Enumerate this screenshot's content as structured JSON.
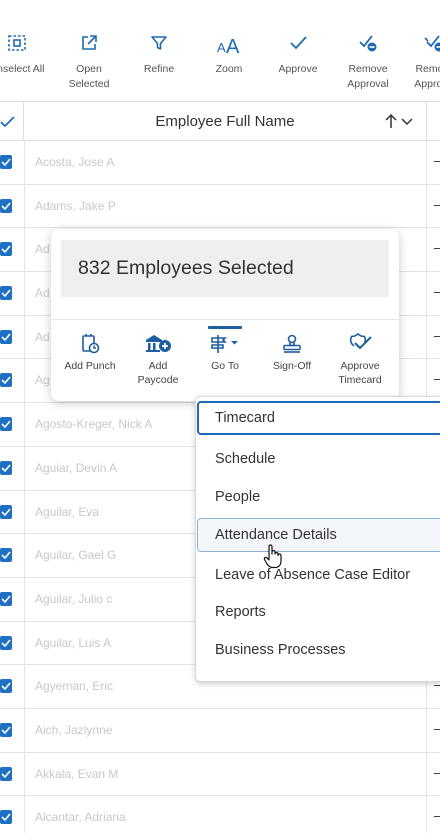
{
  "toolbar": {
    "items": [
      {
        "label": "Unselect All",
        "icon": "unselect-all-icon"
      },
      {
        "label": "Open\nSelected",
        "icon": "open-external-icon"
      },
      {
        "label": "Refine",
        "icon": "filter-icon"
      },
      {
        "label": "Zoom",
        "icon": "zoom-text-icon"
      },
      {
        "label": "Approve",
        "icon": "check-icon"
      },
      {
        "label": "Remove\nApproval",
        "icon": "remove-approval-icon"
      },
      {
        "label": "Remove\nApproval",
        "icon": "remove-approval-icon"
      }
    ]
  },
  "grid": {
    "column_header": "Employee Full Name",
    "rows": [
      "Acosta, Jose A",
      "Adams, Jake P",
      "Ad",
      "Ad",
      "Ad",
      "Ag",
      "Agosto-Kreger, Nick A",
      "Aguiar, Devin A",
      "Aguilar, Eva",
      "Aguilar, Gael G",
      "Aguilar, Julio c",
      "Aguilar, Luis A",
      "Agyeman, Eric",
      "Aich, Jazlynne",
      "Akkala, Evan M",
      "Alcantar, Adriana"
    ]
  },
  "selection_card": {
    "title": "832 Employees Selected",
    "actions": [
      {
        "label": "Add Punch",
        "icon": "add-punch-icon"
      },
      {
        "label": "Add\nPaycode",
        "icon": "add-paycode-icon"
      },
      {
        "label": "Go To",
        "icon": "goto-icon"
      },
      {
        "label": "Sign-Off",
        "icon": "sign-off-stamp-icon"
      },
      {
        "label": "Approve\nTimecard",
        "icon": "approve-timecard-icon"
      }
    ]
  },
  "goto_menu": {
    "items": [
      "Timecard",
      "Schedule",
      "People",
      "Attendance Details",
      "Leave of Absence Case Editor",
      "Reports",
      "Business Processes"
    ]
  },
  "colors": {
    "accent": "#1d6ab3",
    "checkbox": "#1f6fc2",
    "muted_text": "#c8c8c8"
  }
}
